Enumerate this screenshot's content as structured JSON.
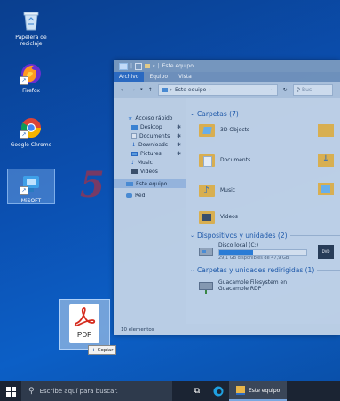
{
  "desktop": {
    "icons": [
      {
        "label": "Papelera de reciclaje",
        "icon": "recycle-bin-icon"
      },
      {
        "label": "Firefox",
        "icon": "firefox-icon"
      },
      {
        "label": "Google Chrome",
        "icon": "chrome-icon"
      },
      {
        "label": "MiSOFT",
        "icon": "misoft-icon"
      }
    ],
    "watermark": "5"
  },
  "explorer": {
    "title": "Este equipo",
    "ribbon_tabs": [
      "Archivo",
      "Equipo",
      "Vista"
    ],
    "address": "Este equipo",
    "search_placeholder": "Bus",
    "nav": {
      "quick_access": "Acceso rápido",
      "items": [
        "Desktop",
        "Documents",
        "Downloads",
        "Pictures",
        "Music",
        "Videos"
      ],
      "this_pc": "Este equipo",
      "network": "Red"
    },
    "folders_header": "Carpetas (7)",
    "folders": [
      "3D Objects",
      "Documents",
      "Music",
      "Videos"
    ],
    "devices_header": "Dispositivos y unidades (2)",
    "drive": {
      "name": "Disco local (C:)",
      "free": "29,1 GB disponibles de 47,9 GB",
      "used_fraction": 0.39
    },
    "network_header": "Carpetas y unidades redirigidas (1)",
    "network_drive": {
      "line1": "Guacamole Filesystem en",
      "line2": "Guacamole RDP"
    },
    "status": "10 elementos"
  },
  "drag": {
    "file_label": "PDF",
    "tooltip": "Copiar"
  },
  "taskbar": {
    "search_placeholder": "Escribe aquí para buscar.",
    "active_window": "Este equipo"
  },
  "colors": {
    "accent": "#2d6cc4",
    "pdf_red": "#d52b1e",
    "folder_yellow": "#e8b64a"
  }
}
